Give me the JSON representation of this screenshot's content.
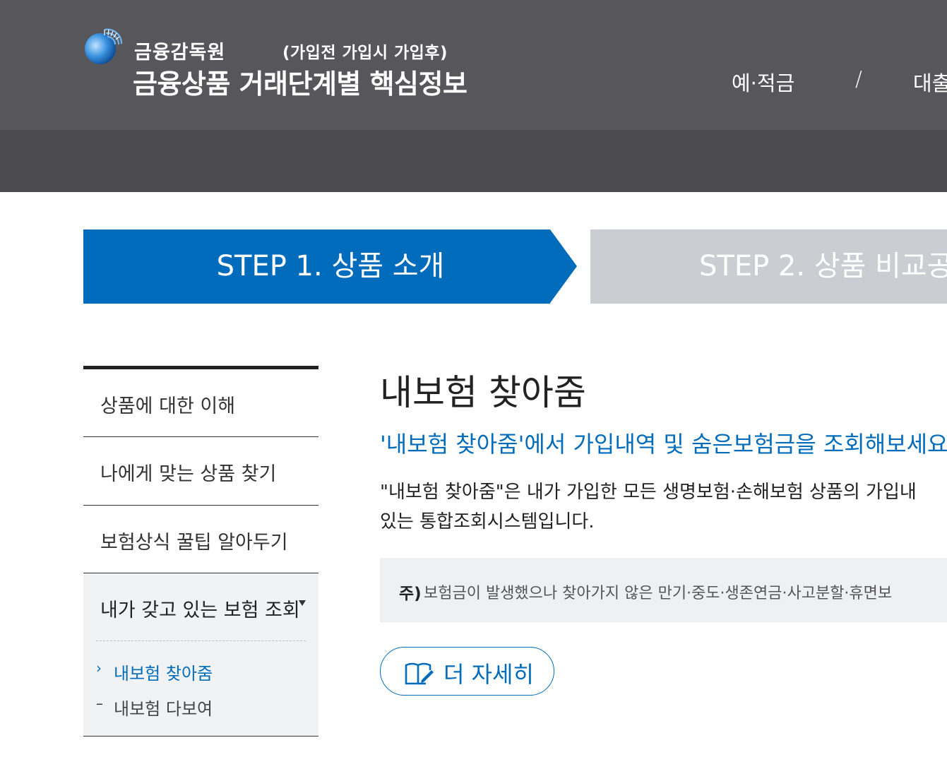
{
  "header": {
    "org_name": "금융감독원",
    "stages": "(가입전  가입시  가입후)",
    "site_title": "금융상품 거래단계별 핵심정보",
    "nav": [
      {
        "label": "예·적금"
      },
      {
        "label": "/"
      },
      {
        "label": "대출"
      }
    ]
  },
  "steps": [
    {
      "label": "STEP 1. 상품 소개",
      "state": "active",
      "color": "#006cbb"
    },
    {
      "label": "STEP 2. 상품 비교공",
      "state": "inactive",
      "color": "#cbcdd2"
    }
  ],
  "sidebar": {
    "items": [
      {
        "label": "상품에 대한 이해"
      },
      {
        "label": "나에게 맞는 상품 찾기"
      },
      {
        "label": "보험상식 꿀팁 알아두기"
      },
      {
        "label": "내가 갖고 있는 보험 조회"
      }
    ],
    "sub_items": [
      {
        "marker": "›",
        "label": "내보험 찾아줌",
        "active": true
      },
      {
        "marker": "–",
        "label": "내보험 다보여",
        "active": false
      }
    ]
  },
  "main": {
    "title": "내보험 찾아줌",
    "subtitle": "'내보험 찾아줌'에서 가입내역 및 숨은보험금을 조회해보세요",
    "description_line1": "\"내보험 찾아줌\"은 내가 가입한 모든 생명보험·손해보험 상품의 가입내",
    "description_line2": "있는 통합조회시스템입니다.",
    "note_label": "주)",
    "note_text": "보험금이 발생했으나 찾아가지 않은 만기·중도·생존연금·사고분할·휴면보",
    "more_button": "더 자세히"
  },
  "icons": {
    "logo": "fss-globe-logo",
    "more": "book-icon",
    "caret": "caret-down-icon"
  },
  "colors": {
    "header": "#56565b",
    "accent": "#006cbb",
    "inactive_step": "#cbcdd2"
  }
}
